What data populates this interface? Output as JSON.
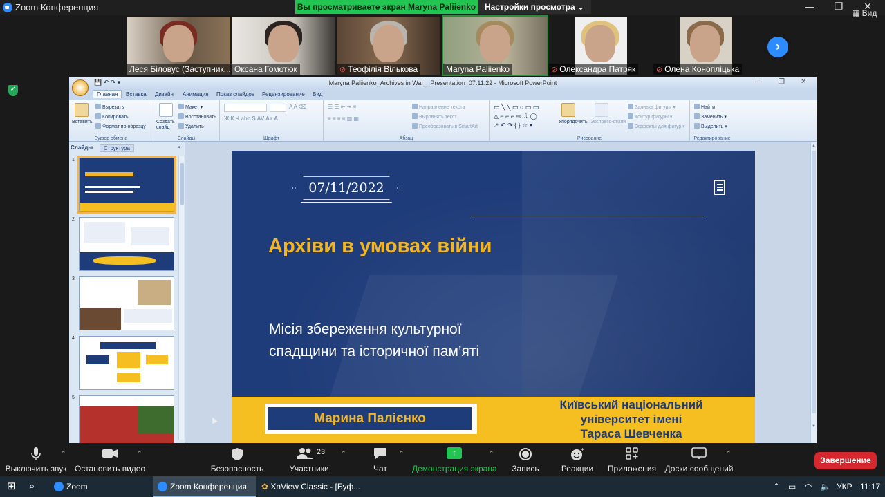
{
  "window": {
    "title": "Zoom Конференция"
  },
  "banner": {
    "viewing": "Вы просматриваете экран Maryna Paliienko",
    "settings": "Настройки просмотра"
  },
  "participants": [
    {
      "name": "Леся Біловус (Заступник...",
      "muted": false
    },
    {
      "name": "Оксана Гомотюк",
      "muted": false
    },
    {
      "name": "Теофілія Вількова",
      "muted": true
    },
    {
      "name": "Maryna Paliienko",
      "muted": false
    },
    {
      "name": "Олександра Патряк",
      "muted": true
    },
    {
      "name": "Олена Конопліцька",
      "muted": true
    }
  ],
  "view_label": "Вид",
  "ppt": {
    "title": "Maryna Paliienko_Archives in War__Presentation_07.11.22 - Microsoft PowerPoint",
    "tabs": [
      "Главная",
      "Вставка",
      "Дизайн",
      "Анимация",
      "Показ слайдов",
      "Рецензирование",
      "Вид"
    ],
    "ribbon": {
      "clipboard": {
        "paste": "Вставить",
        "cut": "Вырезать",
        "copy": "Копировать",
        "format": "Формат по образцу",
        "label": "Буфер обмена"
      },
      "slides": {
        "create": "Создать слайд",
        "layout": "Макет",
        "reset": "Восстановить",
        "delete": "Удалить",
        "label": "Слайды"
      },
      "font": {
        "label": "Шрифт"
      },
      "paragraph": {
        "direction": "Направление текста",
        "align": "Выровнять текст",
        "smartart": "Преобразовать в SmartArt",
        "label": "Абзац"
      },
      "drawing": {
        "arrange": "Упорядочить",
        "quickstyles": "Экспресс-стили",
        "fill": "Заливка фигуры",
        "outline": "Контур фигуры",
        "effects": "Эффекты для фигур",
        "label": "Рисование"
      },
      "editing": {
        "find": "Найти",
        "replace": "Заменить",
        "select": "Выделить",
        "label": "Редактирование"
      }
    },
    "pane": {
      "tab_slides": "Слайды",
      "tab_outline": "Структура",
      "close": "×",
      "numbers": [
        "1",
        "2",
        "3",
        "4",
        "5"
      ]
    },
    "slide": {
      "date": "07/11/2022",
      "title": "Архіви в умовах війни",
      "subtitle": "Місія збереження культурної\nспадщини та історичної пам’яті",
      "presenter": "Марина Палієнко",
      "university": "Київський національний\nуніверситет імені\nТараса Шевченка"
    }
  },
  "toolbar": {
    "audio": "Выключить звук",
    "video": "Остановить видео",
    "security": "Безопасность",
    "participants": "Участники",
    "participants_count": "23",
    "chat": "Чат",
    "share": "Демонстрация экрана",
    "record": "Запись",
    "reactions": "Реакции",
    "apps": "Приложения",
    "whiteboards": "Доски сообщений",
    "end": "Завершение"
  },
  "taskbar": {
    "items": [
      "Zoom",
      "Zoom Конференция",
      "XnView Classic - [Буф..."
    ],
    "lang": "УКР",
    "time": "11:17"
  }
}
